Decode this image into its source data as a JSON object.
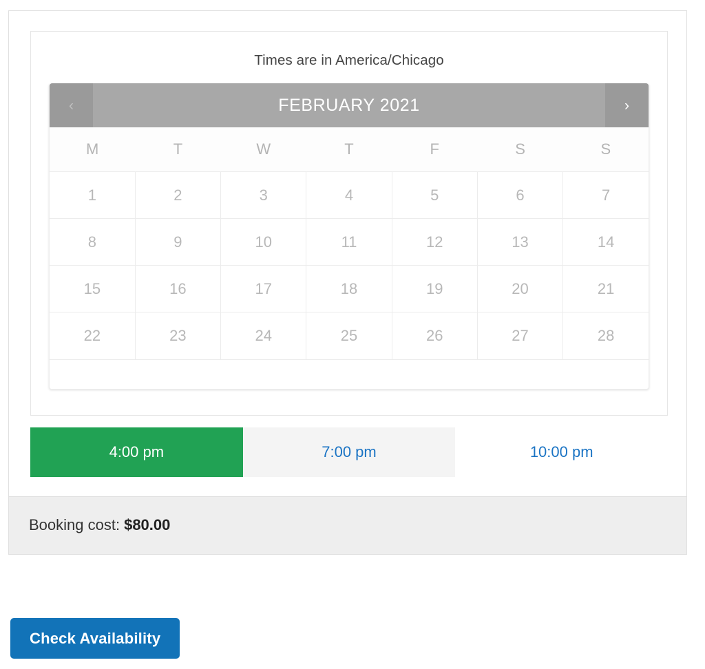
{
  "timezone_note": "Times are in America/Chicago",
  "calendar": {
    "prev_icon": "chevron-left-icon",
    "prev_label": "‹",
    "next_icon": "chevron-right-icon",
    "next_label": "›",
    "title": "FEBRUARY 2021",
    "month": "FEBRUARY",
    "year": "2021",
    "weekdays": [
      "M",
      "T",
      "W",
      "T",
      "F",
      "S",
      "S"
    ],
    "weeks": [
      [
        {
          "day": "1",
          "state": "disabled"
        },
        {
          "day": "2",
          "state": "disabled"
        },
        {
          "day": "3",
          "state": "disabled"
        },
        {
          "day": "4",
          "state": "disabled"
        },
        {
          "day": "5",
          "state": "disabled"
        },
        {
          "day": "6",
          "state": "disabled"
        },
        {
          "day": "7",
          "state": "disabled"
        }
      ],
      [
        {
          "day": "8",
          "state": "disabled"
        },
        {
          "day": "9",
          "state": "disabled"
        },
        {
          "day": "10",
          "state": "disabled"
        },
        {
          "day": "11",
          "state": "disabled"
        },
        {
          "day": "12",
          "state": "disabled"
        },
        {
          "day": "13",
          "state": "disabled"
        },
        {
          "day": "14",
          "state": "disabled"
        }
      ],
      [
        {
          "day": "15",
          "state": "disabled"
        },
        {
          "day": "16",
          "state": "disabled"
        },
        {
          "day": "17",
          "state": "disabled"
        },
        {
          "day": "18",
          "state": "disabled"
        },
        {
          "day": "19",
          "state": "disabled"
        },
        {
          "day": "20",
          "state": "disabled"
        },
        {
          "day": "21",
          "state": "disabled"
        }
      ],
      [
        {
          "day": "22",
          "state": "disabled"
        },
        {
          "day": "23",
          "state": "disabled"
        },
        {
          "day": "24",
          "state": "selected"
        },
        {
          "day": "25",
          "state": "available"
        },
        {
          "day": "26",
          "state": "available"
        },
        {
          "day": "27",
          "state": "available"
        },
        {
          "day": "28",
          "state": "available"
        }
      ]
    ]
  },
  "time_slots": [
    {
      "label": "4:00 pm",
      "state": "selected"
    },
    {
      "label": "7:00 pm",
      "state": "hovered"
    },
    {
      "label": "10:00 pm",
      "state": "default"
    }
  ],
  "cost": {
    "label": "Booking cost:",
    "amount": "$80.00"
  },
  "cta": {
    "label": "Check Availability"
  },
  "colors": {
    "selected_green": "#21a254",
    "available_green": "#2ece73",
    "link_blue": "#1b74c4",
    "button_blue": "#1273b8",
    "header_gray": "#a8a8a8",
    "cost_bar_gray": "#eeeeee"
  }
}
